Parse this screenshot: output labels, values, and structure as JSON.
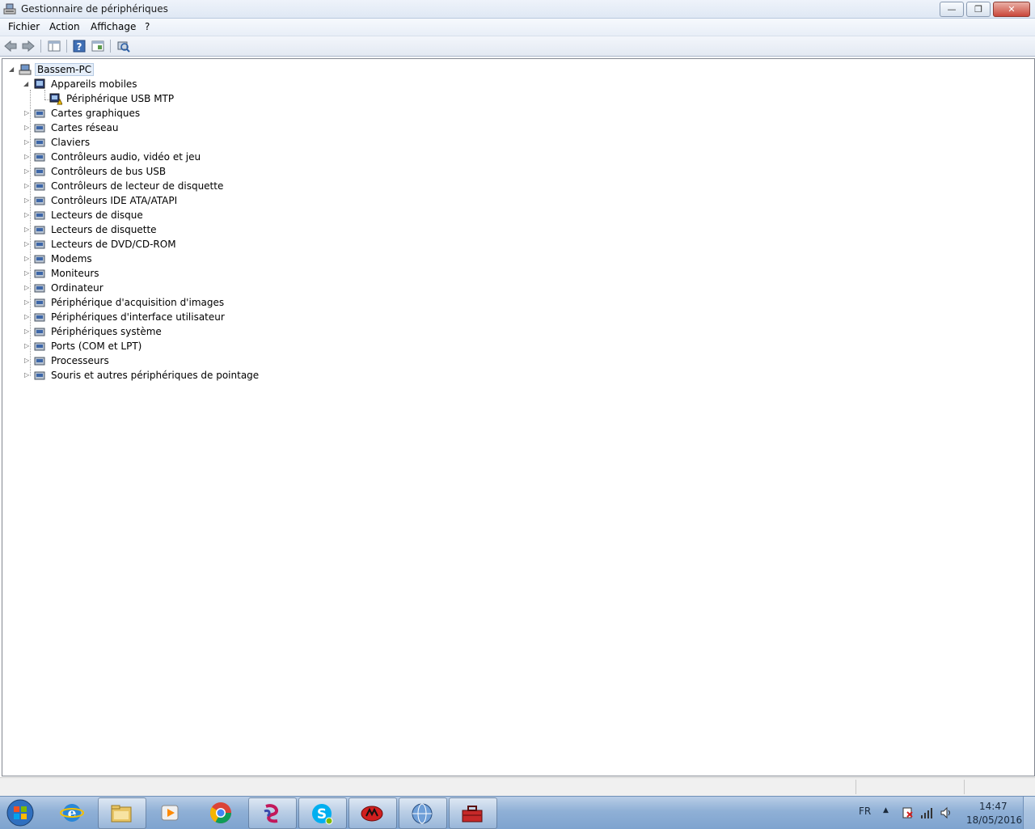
{
  "window": {
    "title": "Gestionnaire de périphériques",
    "icon": "device-manager-icon",
    "buttons": {
      "minimize": "—",
      "maximize": "❐",
      "close": "✕"
    }
  },
  "menu": [
    "Fichier",
    "Action",
    "Affichage",
    "?"
  ],
  "toolbar": [
    "back-arrow-icon",
    "forward-arrow-icon",
    "console-tree-icon",
    "help-icon",
    "properties-view-icon",
    "scan-hardware-icon"
  ],
  "tree": {
    "root": "Bassem-PC",
    "expanded_category": "Appareils mobiles",
    "expanded_child": "Périphérique USB MTP",
    "categories": [
      "Cartes graphiques",
      "Cartes réseau",
      "Claviers",
      "Contrôleurs audio, vidéo et jeu",
      "Contrôleurs de bus USB",
      "Contrôleurs de lecteur de disquette",
      "Contrôleurs IDE ATA/ATAPI",
      "Lecteurs de disque",
      "Lecteurs de disquette",
      "Lecteurs de DVD/CD-ROM",
      "Modems",
      "Moniteurs",
      "Ordinateur",
      "Périphérique d'acquisition d'images",
      "Périphériques d'interface utilisateur",
      "Périphériques système",
      "Ports (COM et LPT)",
      "Processeurs",
      "Souris et autres périphériques de pointage"
    ]
  },
  "taskbar": {
    "apps": [
      "internet-explorer-icon",
      "file-explorer-icon",
      "media-player-icon",
      "chrome-icon",
      "swirl-app-icon",
      "skype-icon",
      "red-app-icon",
      "globe-app-icon",
      "toolbox-icon"
    ],
    "tray": {
      "language": "FR",
      "time": "14:47",
      "date": "18/05/2016"
    }
  },
  "colors": {
    "taskbar": "#8fb0d6",
    "selection": "#e5eef9",
    "warning": "#f2c200"
  }
}
